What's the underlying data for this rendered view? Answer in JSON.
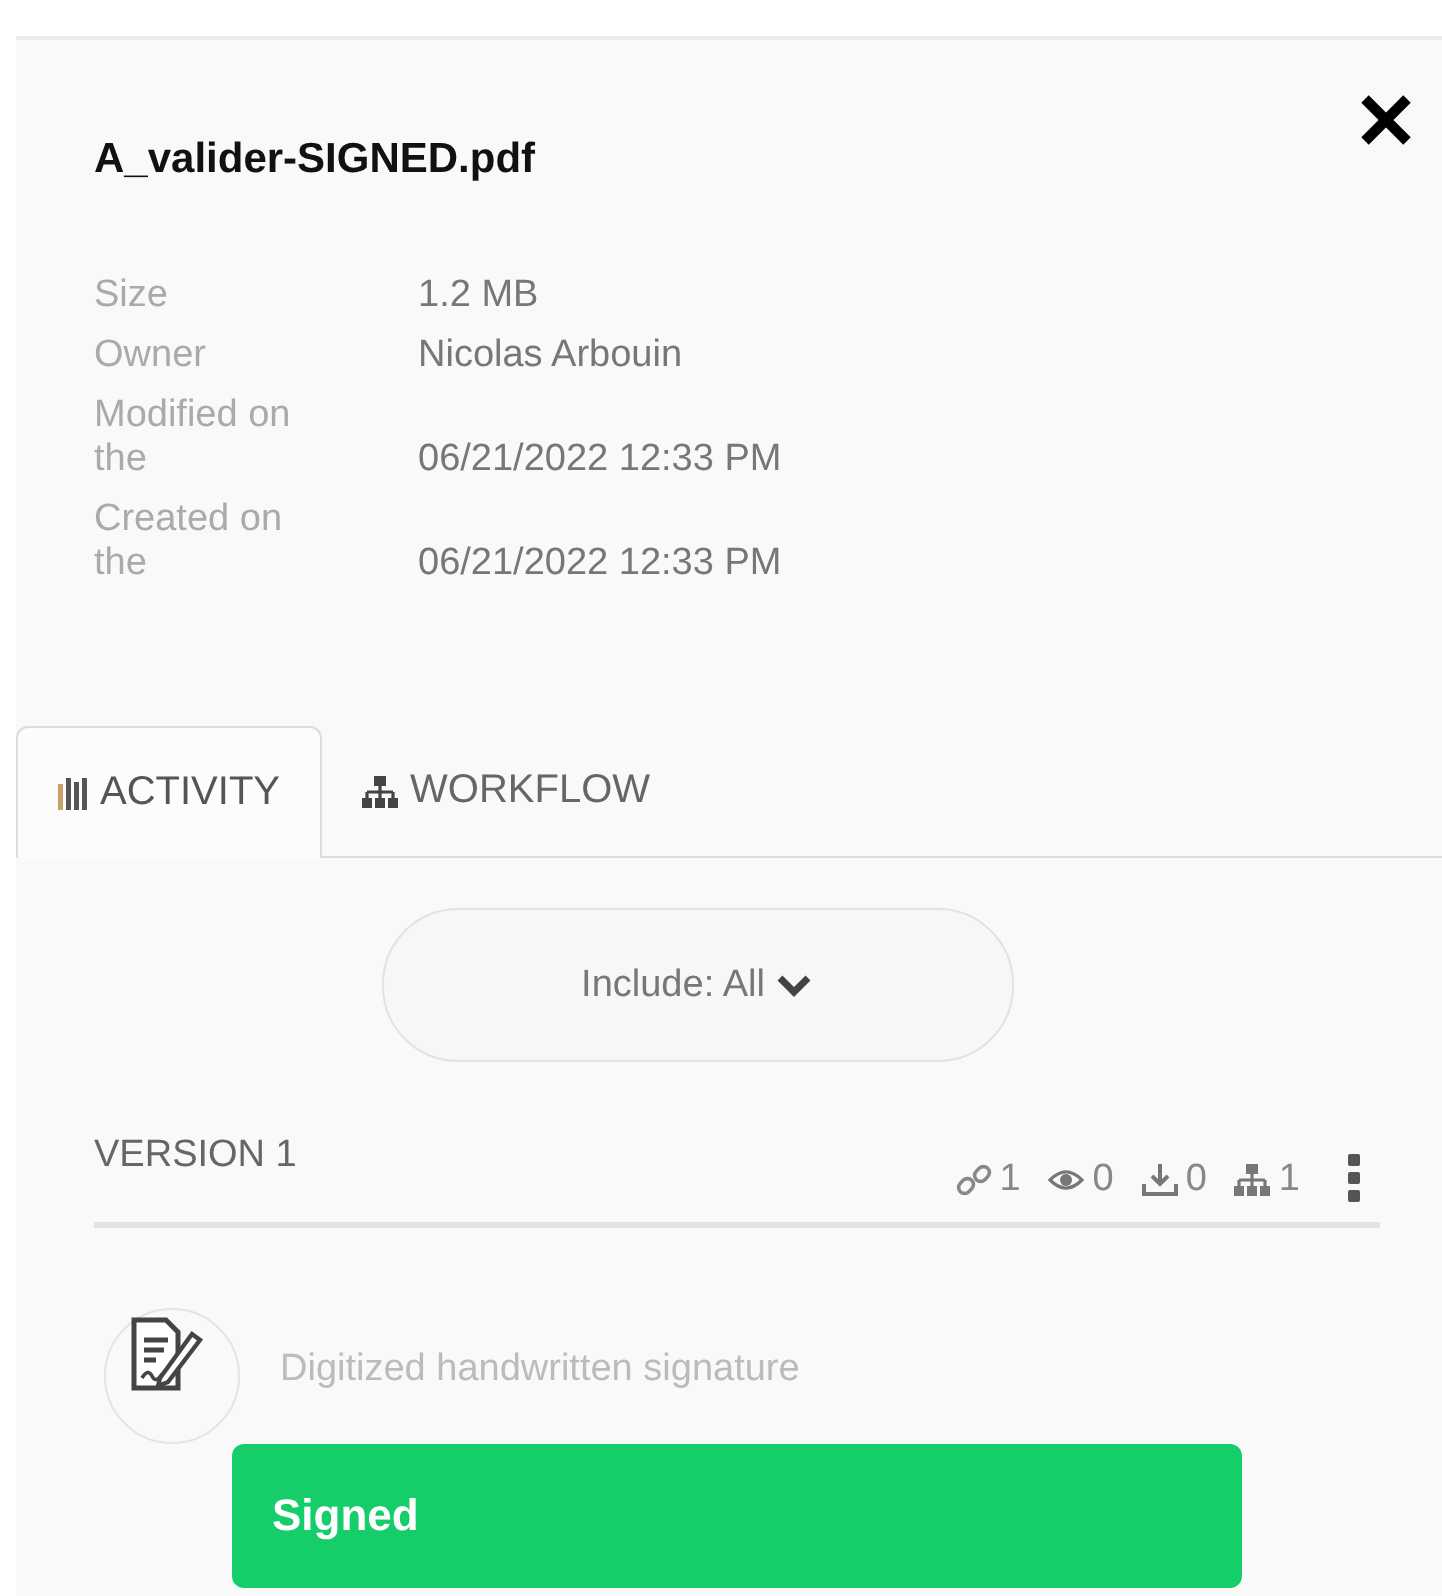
{
  "file": {
    "title": "A_valider-SIGNED.pdf"
  },
  "details": [
    {
      "label": "Size",
      "value": "1.2 MB"
    },
    {
      "label": "Owner",
      "value": "Nicolas Arbouin"
    },
    {
      "label": "Modified on the",
      "value": "06/21/2022 12:33 PM"
    },
    {
      "label": "Created on the",
      "value": "06/21/2022 12:33 PM"
    }
  ],
  "tabs": [
    {
      "label": "ACTIVITY",
      "kind": "activity",
      "selected": true
    },
    {
      "label": "WORKFLOW",
      "kind": "workflow",
      "selected": false
    }
  ],
  "filter": {
    "label": "Include: All"
  },
  "version": {
    "title": "VERSION 1",
    "stats": [
      {
        "kind": "link",
        "count": "1"
      },
      {
        "kind": "views",
        "count": "0"
      },
      {
        "kind": "downloads",
        "count": "0"
      },
      {
        "kind": "workflow",
        "count": "1"
      }
    ]
  },
  "activity": [
    {
      "kind": "signature",
      "description": "Digitized handwritten signature",
      "status": "Signed",
      "color": "#16ce69"
    }
  ]
}
